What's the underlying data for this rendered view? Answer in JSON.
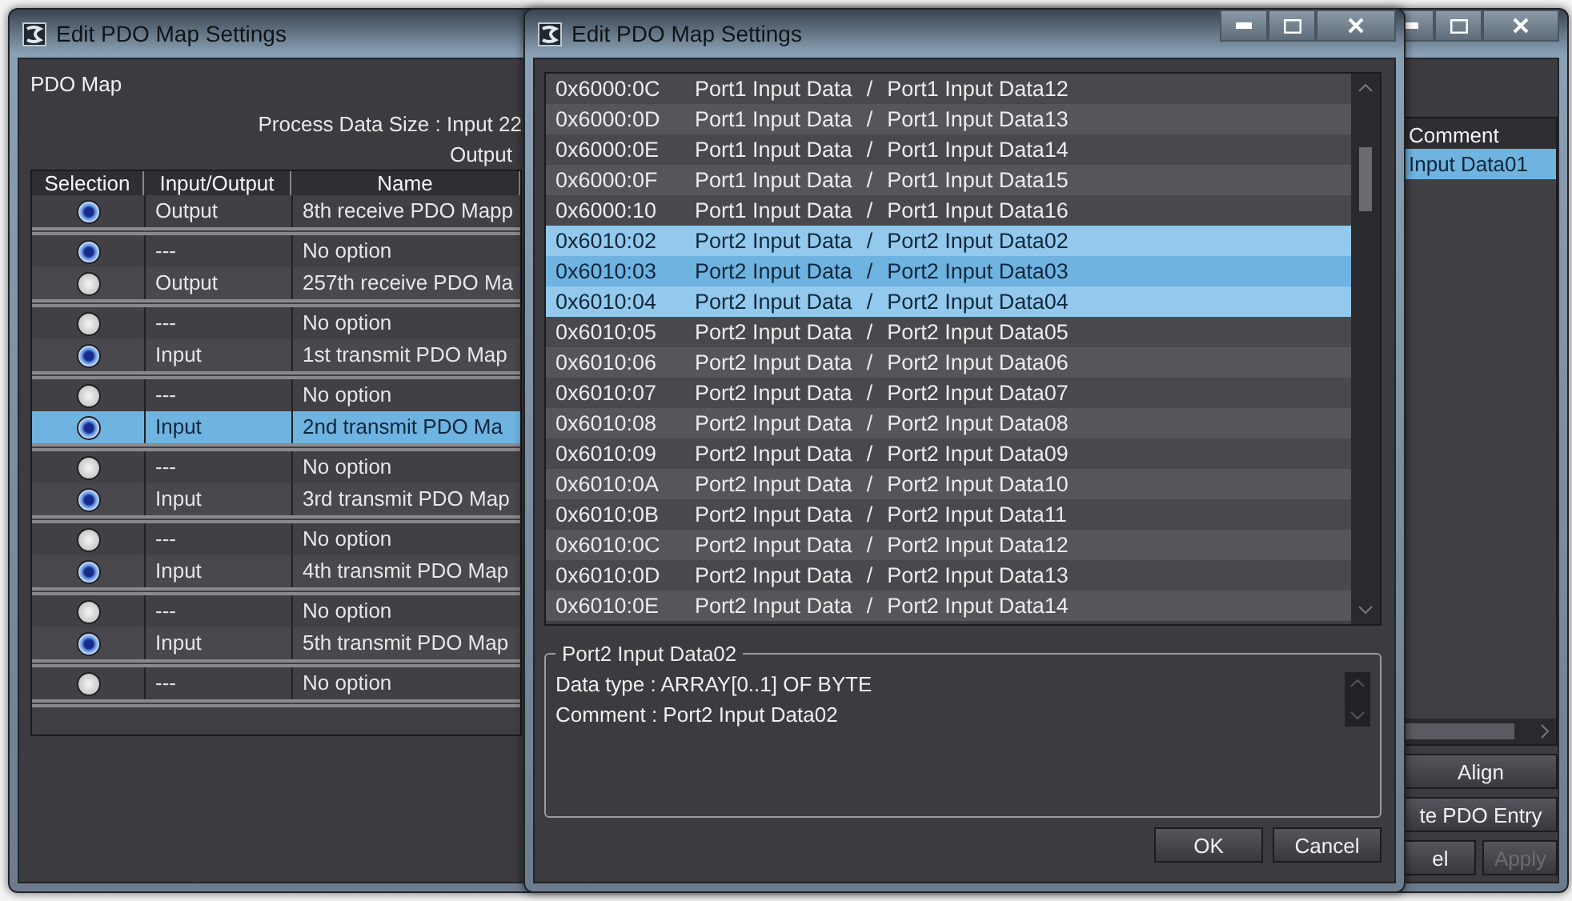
{
  "background_window": {
    "title": "Edit PDO Map Settings",
    "section_label": "PDO Map",
    "process_data_size": "Process Data Size : Input  22",
    "output_size": "Output",
    "table": {
      "columns": [
        "Selection",
        "Input/Output",
        "Name"
      ],
      "groups": [
        {
          "rows": [
            {
              "chosen": true,
              "io": "Output",
              "name": "8th receive PDO Mapp",
              "selected": false
            }
          ]
        },
        {
          "rows": [
            {
              "chosen": true,
              "io": "---",
              "name": "No option",
              "selected": false
            },
            {
              "chosen": false,
              "io": "Output",
              "name": "257th receive PDO Ma",
              "selected": false
            }
          ]
        },
        {
          "rows": [
            {
              "chosen": false,
              "io": "---",
              "name": "No option",
              "selected": false
            },
            {
              "chosen": true,
              "io": "Input",
              "name": "1st transmit PDO Map",
              "selected": false
            }
          ]
        },
        {
          "rows": [
            {
              "chosen": false,
              "io": "---",
              "name": "No option",
              "selected": false
            },
            {
              "chosen": true,
              "io": "Input",
              "name": "2nd transmit PDO Ma",
              "selected": true
            }
          ]
        },
        {
          "rows": [
            {
              "chosen": false,
              "io": "---",
              "name": "No option",
              "selected": false
            },
            {
              "chosen": true,
              "io": "Input",
              "name": "3rd transmit PDO Map",
              "selected": false
            }
          ]
        },
        {
          "rows": [
            {
              "chosen": false,
              "io": "---",
              "name": "No option",
              "selected": false
            },
            {
              "chosen": true,
              "io": "Input",
              "name": "4th transmit PDO Map",
              "selected": false
            }
          ]
        },
        {
          "rows": [
            {
              "chosen": false,
              "io": "---",
              "name": "No option",
              "selected": false
            },
            {
              "chosen": true,
              "io": "Input",
              "name": "5th transmit PDO Map",
              "selected": false
            }
          ]
        },
        {
          "rows": [
            {
              "chosen": false,
              "io": "---",
              "name": "No option",
              "selected": false
            }
          ]
        }
      ]
    },
    "comment_column": {
      "header": "Comment",
      "rows": [
        {
          "text": "Input Data01",
          "selected": true
        }
      ]
    },
    "buttons": [
      {
        "label": "Align",
        "disabled": false
      },
      {
        "label": "te PDO Entry",
        "disabled": false
      },
      {
        "label": "el",
        "disabled": false
      },
      {
        "label": "Apply",
        "disabled": true
      }
    ]
  },
  "dialog": {
    "title": "Edit PDO Map Settings",
    "entries": [
      {
        "index": "0x6000:0C",
        "object": "Port1 Input Data",
        "entry": "Port1 Input Data12",
        "selected": false
      },
      {
        "index": "0x6000:0D",
        "object": "Port1 Input Data",
        "entry": "Port1 Input Data13",
        "selected": false
      },
      {
        "index": "0x6000:0E",
        "object": "Port1 Input Data",
        "entry": "Port1 Input Data14",
        "selected": false
      },
      {
        "index": "0x6000:0F",
        "object": "Port1 Input Data",
        "entry": "Port1 Input Data15",
        "selected": false
      },
      {
        "index": "0x6000:10",
        "object": "Port1 Input Data",
        "entry": "Port1 Input Data16",
        "selected": false
      },
      {
        "index": "0x6010:02",
        "object": "Port2 Input Data",
        "entry": "Port2 Input Data02",
        "selected": true
      },
      {
        "index": "0x6010:03",
        "object": "Port2 Input Data",
        "entry": "Port2 Input Data03",
        "selected": true
      },
      {
        "index": "0x6010:04",
        "object": "Port2 Input Data",
        "entry": "Port2 Input Data04",
        "selected": true
      },
      {
        "index": "0x6010:05",
        "object": "Port2 Input Data",
        "entry": "Port2 Input Data05",
        "selected": false
      },
      {
        "index": "0x6010:06",
        "object": "Port2 Input Data",
        "entry": "Port2 Input Data06",
        "selected": false
      },
      {
        "index": "0x6010:07",
        "object": "Port2 Input Data",
        "entry": "Port2 Input Data07",
        "selected": false
      },
      {
        "index": "0x6010:08",
        "object": "Port2 Input Data",
        "entry": "Port2 Input Data08",
        "selected": false
      },
      {
        "index": "0x6010:09",
        "object": "Port2 Input Data",
        "entry": "Port2 Input Data09",
        "selected": false
      },
      {
        "index": "0x6010:0A",
        "object": "Port2 Input Data",
        "entry": "Port2 Input Data10",
        "selected": false
      },
      {
        "index": "0x6010:0B",
        "object": "Port2 Input Data",
        "entry": "Port2 Input Data11",
        "selected": false
      },
      {
        "index": "0x6010:0C",
        "object": "Port2 Input Data",
        "entry": "Port2 Input Data12",
        "selected": false
      },
      {
        "index": "0x6010:0D",
        "object": "Port2 Input Data",
        "entry": "Port2 Input Data13",
        "selected": false
      },
      {
        "index": "0x6010:0E",
        "object": "Port2 Input Data",
        "entry": "Port2 Input Data14",
        "selected": false
      }
    ],
    "separator": "/",
    "details": {
      "title": "Port2 Input Data02",
      "lines": [
        "Data type : ARRAY[0..1] OF BYTE",
        "Comment : Port2 Input Data02"
      ]
    },
    "buttons": [
      "OK",
      "Cancel"
    ]
  }
}
